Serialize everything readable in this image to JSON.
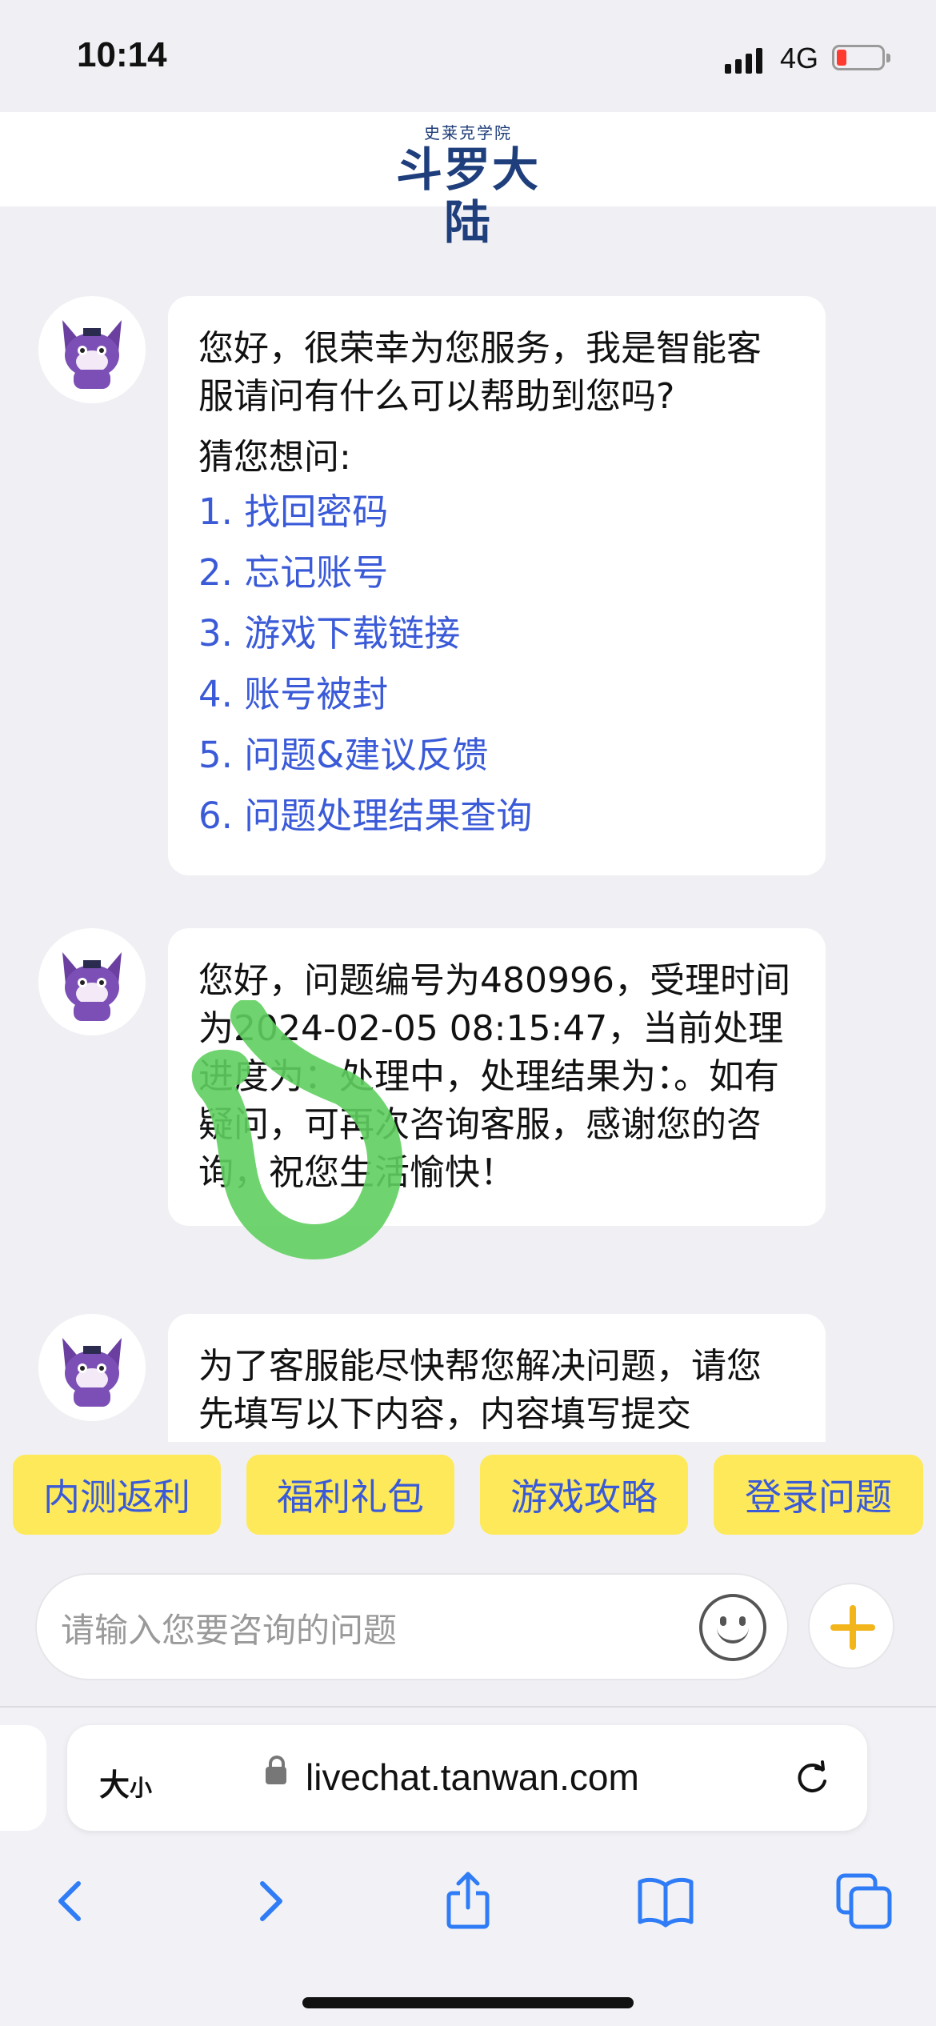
{
  "status_bar": {
    "time": "10:14",
    "network": "4G"
  },
  "header": {
    "logo_subtitle": "史莱克学院",
    "logo_title": "斗罗大陆"
  },
  "chat": {
    "messages": [
      {
        "line1": "您好，很荣幸为您服务，我是智能客服请问有什么可以帮助到您吗?",
        "guess_label": "猜您想问:",
        "options": [
          "1. 找回密码",
          "2. 忘记账号",
          "3. 游戏下载链接",
          "4. 账号被封",
          "5. 问题&建议反馈",
          "6. 问题处理结果查询"
        ]
      },
      {
        "text": "您好，问题编号为480996，受理时间为2024-02-05 08:15:47，当前处理进度为：处理中，处理结果为：。如有疑问，可再次咨询客服，感谢您的咨询，祝您生活愉快！"
      },
      {
        "text": "为了客服能尽快帮您解决问题，请您先填写以下内容，内容填写提交"
      }
    ]
  },
  "quick_replies": [
    "内测返利",
    "福利礼包",
    "游戏攻略",
    "登录问题"
  ],
  "input": {
    "placeholder": "请输入您要咨询的问题"
  },
  "browser": {
    "text_size_label": "大",
    "text_size_small": "小",
    "url": "livechat.tanwan.com"
  },
  "colors": {
    "link": "#3a5ad8",
    "quick_reply_bg": "#fde95a",
    "annotation": "#5fcf5f",
    "plus_icon": "#f2b51c"
  }
}
